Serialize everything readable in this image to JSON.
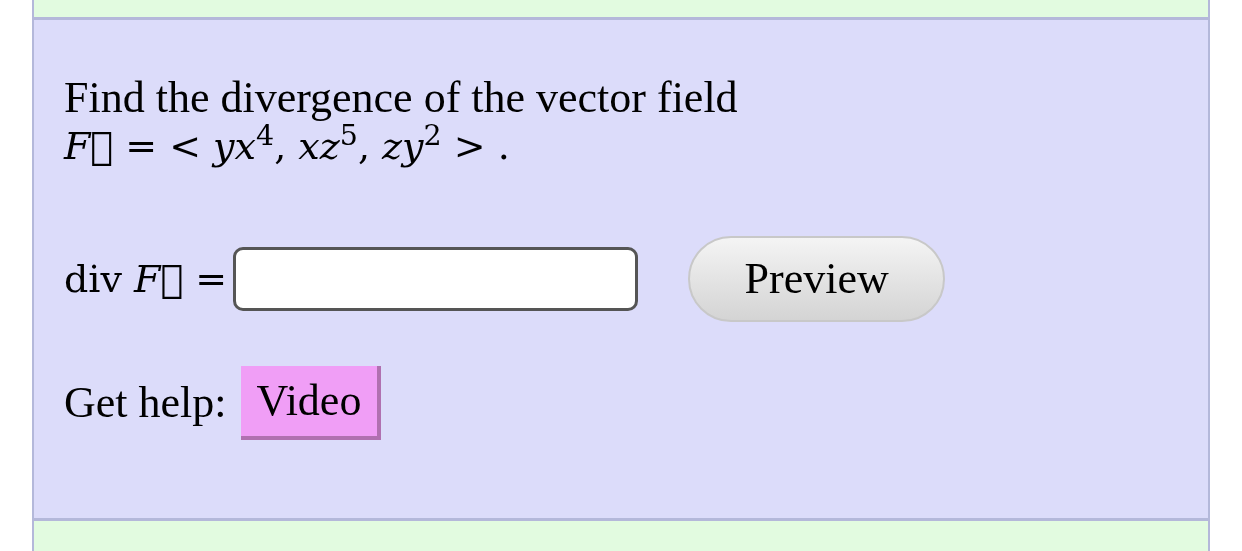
{
  "question": {
    "prompt": "Find the divergence of the vector field",
    "formula": "*F⃗* = < *yx*$^{4}$, *xz*$^{5}$, *zy*$^{2}$ > ."
  },
  "answer": {
    "label": "div *F⃗* ="
  },
  "preview_button": "Preview",
  "help": {
    "label": "Get help:",
    "links": [
      "Video"
    ]
  }
}
